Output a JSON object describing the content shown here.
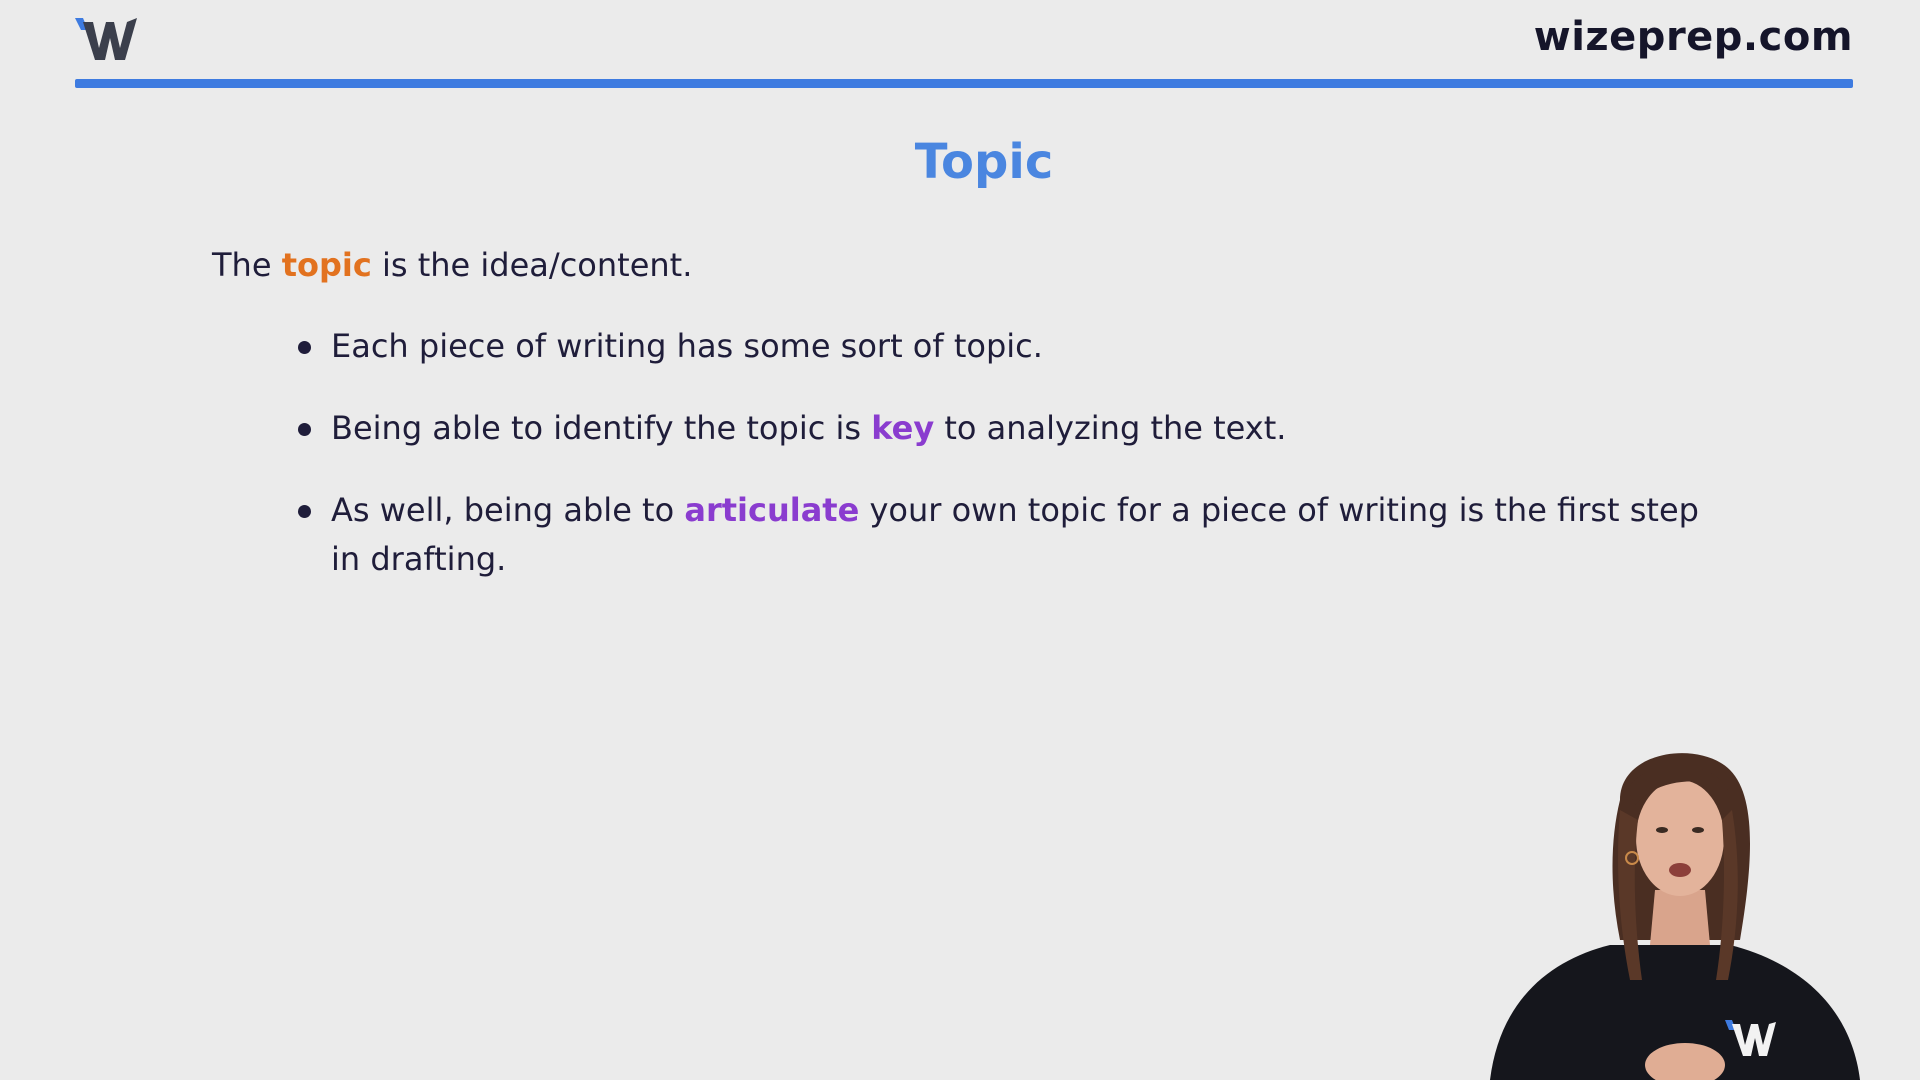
{
  "header": {
    "site_url": "wizeprep.com",
    "logo_icon": "wizeprep-w-logo-icon",
    "accent_color": "#3e7be0"
  },
  "slide": {
    "title": "Topic",
    "intro": {
      "before": "The ",
      "highlight": "topic",
      "after": " is the idea/content."
    },
    "bullets": [
      {
        "before": "Each piece of writing has some sort of topic.",
        "highlight": "",
        "after": ""
      },
      {
        "before": "Being able to identify the topic is ",
        "highlight": "key",
        "after": " to analyzing the text."
      },
      {
        "before": "As well, being able to ",
        "highlight": "articulate",
        "after": " your own topic for a piece of writing is the first step in drafting."
      }
    ]
  },
  "colors": {
    "title": "#4a86e0",
    "highlight_orange": "#e2721f",
    "highlight_purple": "#8a3ccf",
    "text": "#1f1d3a",
    "background": "#ebebeb"
  },
  "presenter": {
    "icon": "presenter-avatar-icon"
  }
}
